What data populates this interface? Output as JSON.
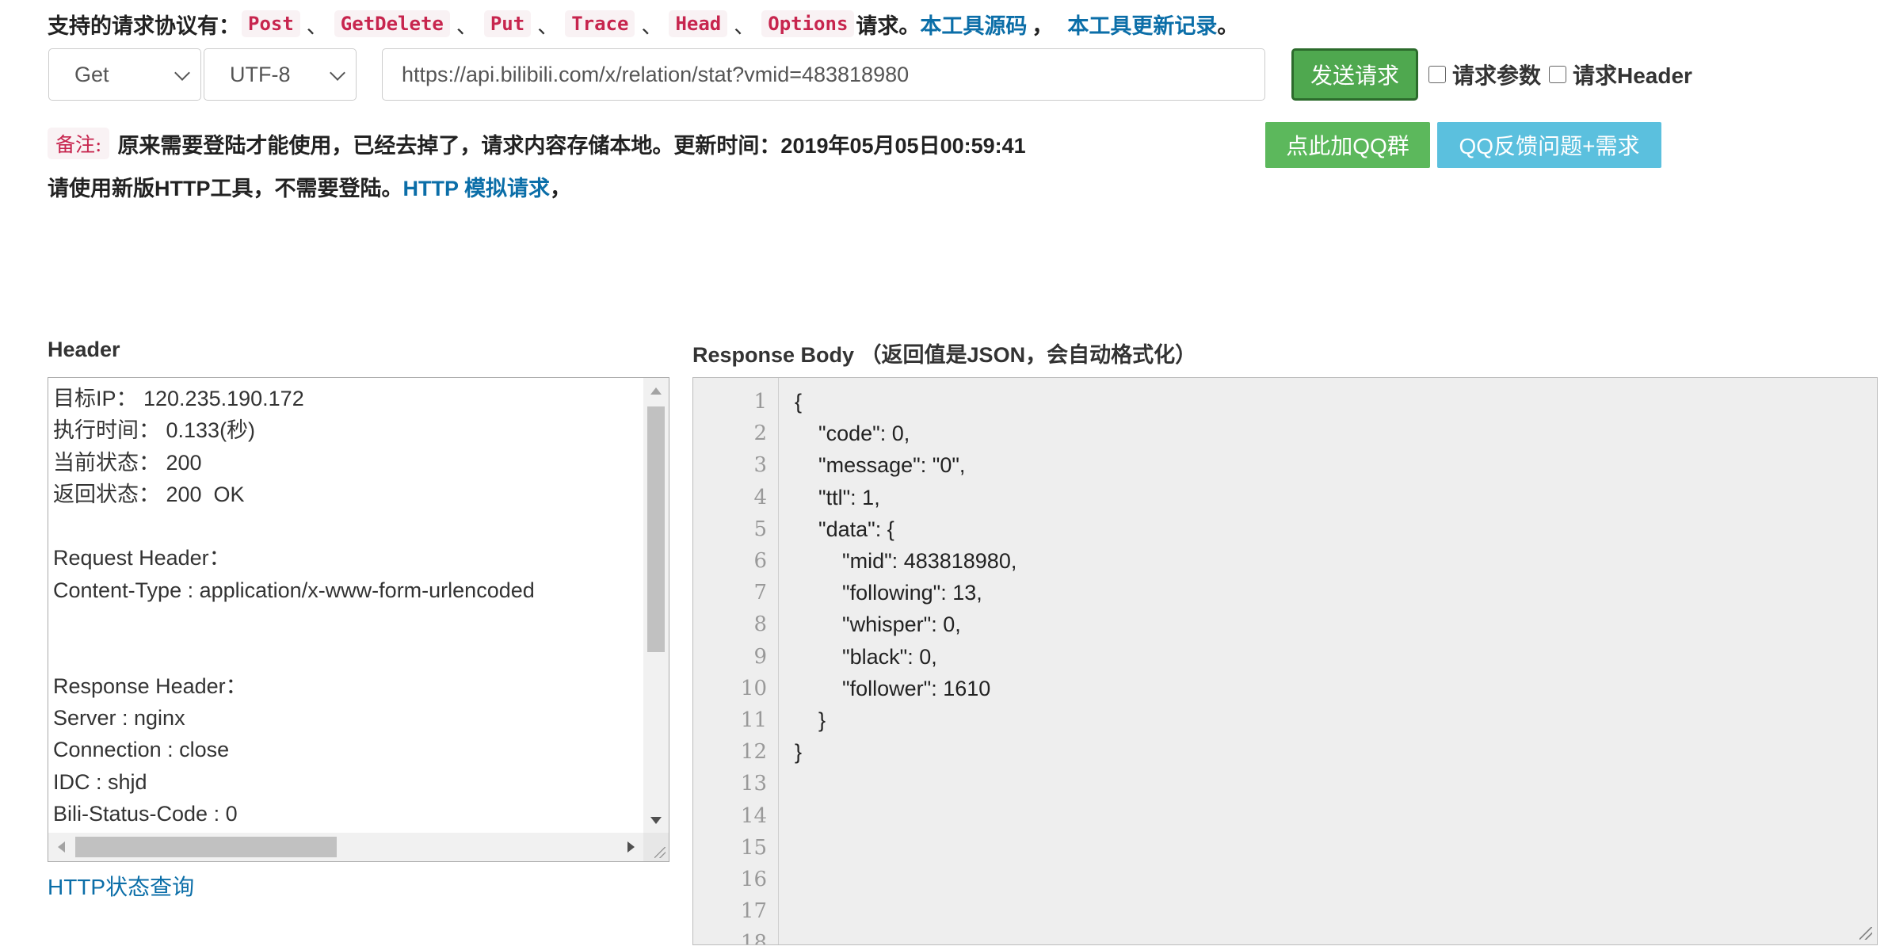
{
  "protocols": {
    "label": "支持的请求协议有：",
    "items": [
      "Post",
      "GetDelete",
      "Put",
      "Trace",
      "Head",
      "Options"
    ],
    "separator": "、",
    "suffix": "请求。",
    "source_link": "本工具源码",
    "comma": "，",
    "changelog_link": "本工具更新记录",
    "end": "。"
  },
  "request": {
    "method": "Get",
    "charset": "UTF-8",
    "url": "https://api.bilibili.com/x/relation/stat?vmid=483818980",
    "send_label": "发送请求",
    "params_label": "请求参数",
    "header_label": "请求Header"
  },
  "notes": {
    "badge": "备注:",
    "line1": "原来需要登陆才能使用，已经去掉了，请求内容存储本地。更新时间：2019年05月05日00:59:41",
    "line2_prefix": "请使用新版HTTP工具，不需要登陆。",
    "line2_link": "HTTP 模拟请求",
    "line2_suffix": "，"
  },
  "buttons": {
    "qq_group": "点此加QQ群",
    "qq_feedback": "QQ反馈问题+需求"
  },
  "header_panel": {
    "title": "Header",
    "lines": [
      "目标IP： 120.235.190.172",
      "执行时间： 0.133(秒)",
      "当前状态： 200",
      "返回状态： 200  OK",
      "",
      "Request Header：",
      "Content-Type : application/x-www-form-urlencoded",
      "",
      "",
      "Response Header：",
      "Server : nginx",
      "Connection : close",
      "IDC : shjd",
      "Bili-Status-Code : 0"
    ],
    "status_link": "HTTP状态查询"
  },
  "response": {
    "title": "Response Body （返回值是JSON，会自动格式化）",
    "line_numbers": [
      "1",
      "2",
      "3",
      "4",
      "5",
      "6",
      "7",
      "8",
      "9",
      "10",
      "11",
      "12",
      "13",
      "14",
      "15",
      "16",
      "17",
      "18"
    ],
    "code_lines": [
      "{",
      "    \"code\": 0,",
      "    \"message\": \"0\",",
      "    \"ttl\": 1,",
      "    \"data\": {",
      "        \"mid\": 483818980,",
      "        \"following\": 13,",
      "        \"whisper\": 0,",
      "        \"black\": 0,",
      "        \"follower\": 1610",
      "    }",
      "}"
    ]
  }
}
